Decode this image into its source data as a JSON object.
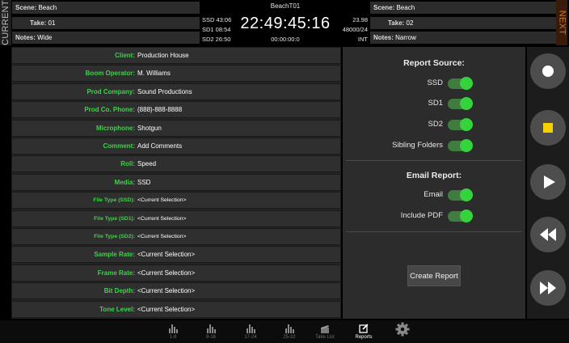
{
  "labels": {
    "current": "CURRENT",
    "next": "NEXT"
  },
  "slate_current": {
    "scene_label": "Scene:",
    "scene": "Beach",
    "take_label": "Take:",
    "take": "01",
    "notes_label": "Notes:",
    "notes": "Wide"
  },
  "slate_next": {
    "scene_label": "Scene:",
    "scene": "Beach",
    "take_label": "Take:",
    "take": "02",
    "notes_label": "Notes:",
    "notes": "Narrow"
  },
  "timecode_panel": {
    "name": "BeachT01",
    "ssd": "SSD 43:06",
    "sd1": "SD1 08:54",
    "sd2": "SD2 26:50",
    "timecode": "22:49:45:16",
    "sub_timecode": "00:00:00:0",
    "frame_rate": "23.98",
    "sample": "48000/24",
    "source": "INT"
  },
  "metadata_form": [
    {
      "label": "Client:",
      "value": "Production House"
    },
    {
      "label": "Boom Operator:",
      "value": "M. Williams"
    },
    {
      "label": "Prod Company:",
      "value": "Sound Productions"
    },
    {
      "label": "Prod Co. Phone:",
      "value": "(888)-888-8888"
    },
    {
      "label": "Microphone:",
      "value": "Shotgun"
    },
    {
      "label": "Comment:",
      "value": "Add Comments"
    },
    {
      "label": "Roll:",
      "value": "Speed"
    },
    {
      "label": "Media:",
      "value": "SSD"
    },
    {
      "label": "File Type (SSD):",
      "value": "<Current Selection>"
    },
    {
      "label": "File Type (SD1):",
      "value": "<Current Selection>"
    },
    {
      "label": "File Type (SD2):",
      "value": "<Current Selection>"
    },
    {
      "label": "Sample Rate:",
      "value": "<Current Selection>"
    },
    {
      "label": "Frame Rate:",
      "value": "<Current Selection>"
    },
    {
      "label": "Bit Depth:",
      "value": "<Current Selection>"
    },
    {
      "label": "Tone Level:",
      "value": "<Current Selection>"
    }
  ],
  "report_source": {
    "heading": "Report Source:",
    "options": [
      {
        "label": "SSD",
        "on": true
      },
      {
        "label": "SD1",
        "on": true
      },
      {
        "label": "SD2",
        "on": true
      },
      {
        "label": "Sibling Folders",
        "on": true
      }
    ]
  },
  "email_report": {
    "heading": "Email Report:",
    "options": [
      {
        "label": "Email",
        "on": true
      },
      {
        "label": "Include PDF",
        "on": true
      }
    ]
  },
  "create_report_label": "Create Report",
  "colors": {
    "accent_green": "#35d43f",
    "label_green": "#3ed24a",
    "stop_yellow": "#f4d000",
    "next_orange": "#d27a28"
  },
  "transport": [
    {
      "name": "record-button",
      "icon": "record-icon"
    },
    {
      "name": "stop-button",
      "icon": "stop-icon"
    },
    {
      "name": "play-button",
      "icon": "play-icon"
    },
    {
      "name": "rewind-button",
      "icon": "rewind-icon"
    },
    {
      "name": "fast-forward-button",
      "icon": "fast-forward-icon"
    }
  ],
  "bottom_nav": [
    {
      "label": "1-8",
      "icon": "meters-icon"
    },
    {
      "label": "9-16",
      "icon": "meters-icon"
    },
    {
      "label": "17-24",
      "icon": "meters-icon"
    },
    {
      "label": "25-32",
      "icon": "meters-icon"
    },
    {
      "label": "Take List",
      "icon": "take-list-icon"
    },
    {
      "label": "Reports",
      "icon": "edit-icon",
      "active": true
    },
    {
      "label": "",
      "icon": "gear-icon"
    }
  ]
}
